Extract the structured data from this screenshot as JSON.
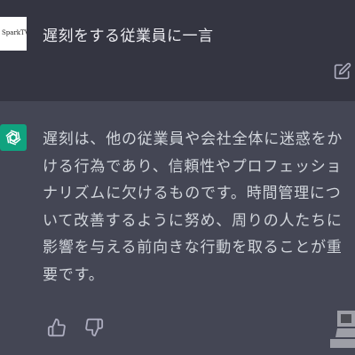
{
  "user_message": {
    "avatar_text": "SparkTV",
    "text": "遅刻をする従業員に一言"
  },
  "assistant_message": {
    "lines": [
      "遅刻は、他の従業員や会社全体に迷惑をか",
      "ける行為であり、信頼性やプロフェッショ",
      "ナリズムに欠けるものです。時間管理につ",
      "いて改善するように努め、周りの人たちに",
      "影響を与える前向きな行動を取ることが重",
      "要です。"
    ]
  },
  "icons": {
    "edit": "edit-pencil-icon",
    "assistant_avatar": "openai-logo-icon",
    "thumbs_up": "thumbs-up-icon",
    "thumbs_down": "thumbs-down-icon"
  },
  "colors": {
    "user_bg": "#343541",
    "assistant_bg": "#444654",
    "avatar_green": "#10a37f",
    "text_primary": "#ececf1",
    "text_secondary": "#d1d5db",
    "icon_gray": "#acacbe"
  }
}
